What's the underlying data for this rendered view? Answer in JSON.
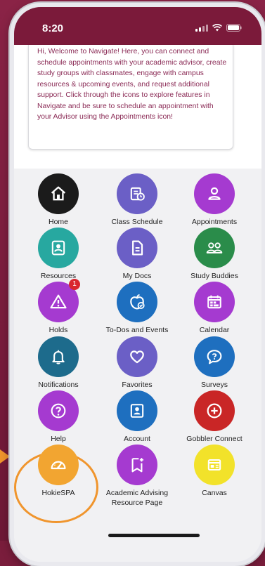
{
  "status": {
    "time": "8:20"
  },
  "welcome": {
    "text": "Hi, Welcome to Navigate! Here, you can connect and schedule appointments with your academic advisor, create study groups with classmates, engage with campus resources & upcoming events, and request additional support. Click through the icons to explore features in Navigate and be sure to schedule an appointment with your Advisor using the Appointments icon!"
  },
  "tiles": [
    {
      "label": "Home",
      "icon": "home-icon",
      "color": "#1b1b1b"
    },
    {
      "label": "Class Schedule",
      "icon": "class-schedule-icon",
      "color": "#6b5fc6"
    },
    {
      "label": "Appointments",
      "icon": "person-icon",
      "color": "#a53ad0"
    },
    {
      "label": "Resources",
      "icon": "resources-icon",
      "color": "#27a8a0"
    },
    {
      "label": "My Docs",
      "icon": "document-icon",
      "color": "#6b5fc6"
    },
    {
      "label": "Study Buddies",
      "icon": "study-buddies-icon",
      "color": "#2a8c4a"
    },
    {
      "label": "Holds",
      "icon": "warning-icon",
      "color": "#a53ad0",
      "badge": "1"
    },
    {
      "label": "To-Dos and Events",
      "icon": "todo-icon",
      "color": "#1e6fbf"
    },
    {
      "label": "Calendar",
      "icon": "calendar-icon",
      "color": "#a53ad0"
    },
    {
      "label": "Notifications",
      "icon": "bell-icon",
      "color": "#1d6b8c"
    },
    {
      "label": "Favorites",
      "icon": "heart-icon",
      "color": "#6b5fc6"
    },
    {
      "label": "Surveys",
      "icon": "chat-bubble-icon",
      "color": "#1e6fbf"
    },
    {
      "label": "Help",
      "icon": "help-icon",
      "color": "#a53ad0"
    },
    {
      "label": "Account",
      "icon": "account-icon",
      "color": "#1e6fbf"
    },
    {
      "label": "Gobbler Connect",
      "icon": "plus-circle-icon",
      "color": "#c92626"
    },
    {
      "label": "HokieSPA",
      "icon": "dashboard-icon",
      "color": "#f2a531"
    },
    {
      "label": "Academic Advising Resource Page",
      "label_line1": "Academic Advising",
      "label_line2": "Resource Page",
      "icon": "bookmark-plus-icon",
      "color": "#a53ad0"
    },
    {
      "label": "Canvas",
      "icon": "canvas-icon",
      "color": "#f2e22a"
    }
  ]
}
